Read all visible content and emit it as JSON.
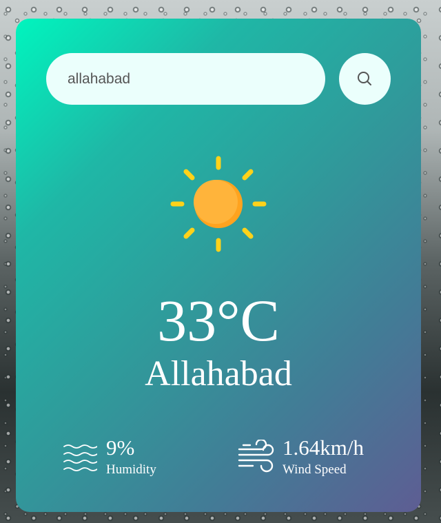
{
  "search": {
    "value": "allahabad",
    "icon": "search-icon"
  },
  "weather": {
    "icon": "sun-icon",
    "temperature": "33°C",
    "city": "Allahabad"
  },
  "details": {
    "humidity": {
      "icon": "humidity-waves-icon",
      "value": "9%",
      "label": "Humidity"
    },
    "wind": {
      "icon": "wind-icon",
      "value": "1.64km/h",
      "label": "Wind Speed"
    }
  },
  "colors": {
    "card_gradient_start": "#00f5be",
    "card_gradient_end": "#5e5d93",
    "sun": "#ffb43b",
    "sun_rays": "#ffd21a",
    "input_background": "#ebfffc"
  }
}
